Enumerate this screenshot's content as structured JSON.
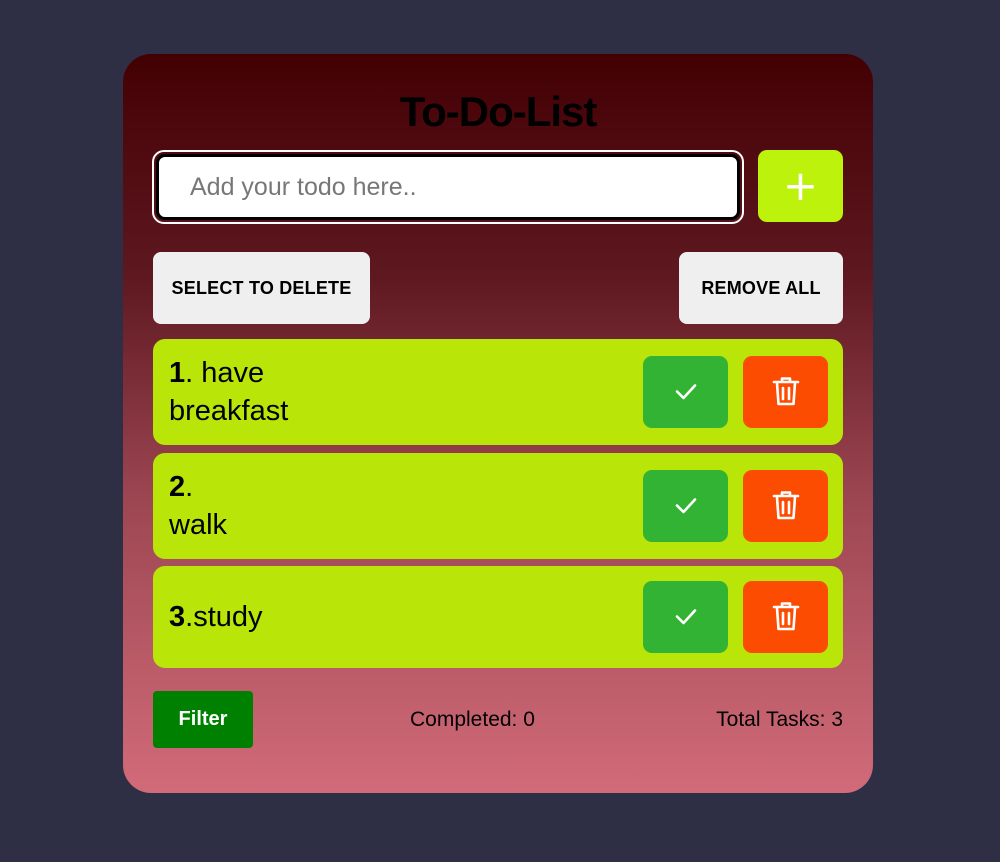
{
  "app": {
    "title": "To-Do-List"
  },
  "input": {
    "placeholder": "Add your todo here..",
    "value": "",
    "add_label": "+"
  },
  "controls": {
    "select_to_delete": "SELECT TO DELETE",
    "remove_all": "REMOVE ALL"
  },
  "todos": [
    {
      "number": "1",
      "text": ". have\nbreakfast",
      "completed": false
    },
    {
      "number": "2",
      "text": ".\nwalk",
      "completed": false
    },
    {
      "number": "3",
      "text": ".study",
      "completed": false
    }
  ],
  "icons": {
    "done": "check-icon",
    "delete": "trash-icon"
  },
  "footer": {
    "filter_label": "Filter",
    "completed_text": "Completed: 0",
    "total_text": "Total Tasks: 3"
  },
  "colors": {
    "background": "#2e2f45",
    "card_top": "#430003",
    "card_bottom": "#d26b79",
    "item_bg": "#b9e508",
    "add_button": "#bdf20c",
    "done_button": "#33b333",
    "delete_button": "#fc4c02",
    "filter_button": "#008000"
  }
}
